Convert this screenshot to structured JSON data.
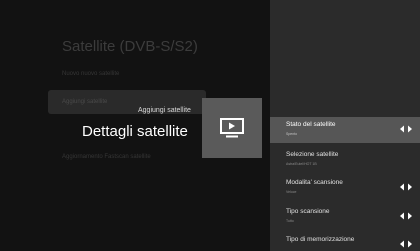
{
  "background_menu": {
    "title": "Satellite (DVB-S/S2)",
    "items": [
      {
        "label": "Nuovo nuovo satellite"
      },
      {
        "label": "Aggiungi satellite"
      },
      {
        "label": "Aggiornamento Fastscan satellite"
      }
    ]
  },
  "focus": {
    "add_satellite_label": "Aggiungi satellite",
    "details_label": "Dettagli satellite",
    "icon": "tv-play-icon"
  },
  "settings_panel": {
    "rows": [
      {
        "label": "Stato del satellite",
        "value": "Spento",
        "selected": true,
        "arrows": true
      },
      {
        "label": "Selezione satellite",
        "value": "Astra/Eutel/HOT 1B",
        "selected": false,
        "arrows": false
      },
      {
        "label": "Modalita' scansione",
        "value": "Veloce",
        "selected": false,
        "arrows": true
      },
      {
        "label": "Tipo scansione",
        "value": "Tutto",
        "selected": false,
        "arrows": true
      },
      {
        "label": "Tipo di memorizzazione",
        "value": "",
        "selected": false,
        "arrows": true
      }
    ]
  },
  "colors": {
    "panel_bg": "#2b2b2b",
    "selected_row_bg": "#565656",
    "icon_card_bg": "#5a5a5a"
  }
}
